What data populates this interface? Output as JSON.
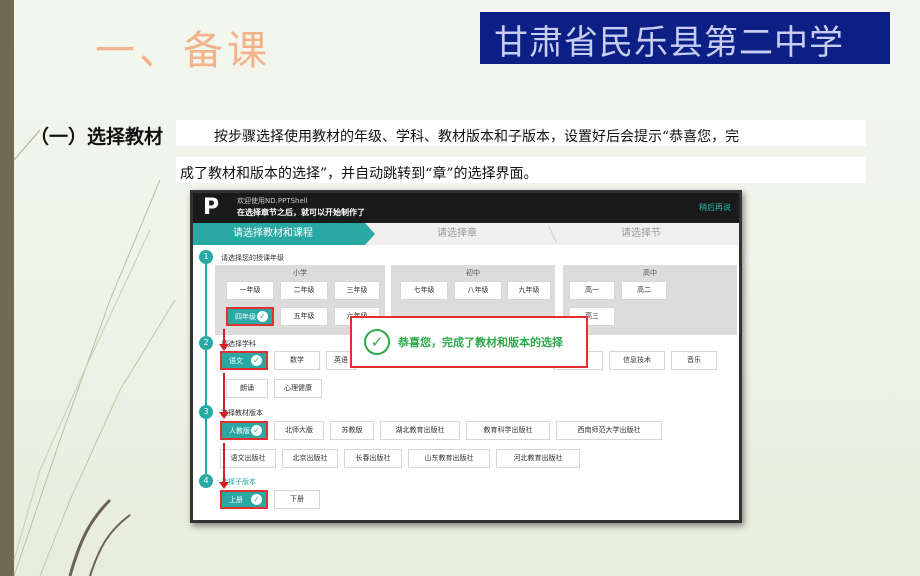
{
  "slide": {
    "title": "一、备课",
    "school": "甘肃省民乐县第二中学",
    "section_label": "（一）选择教材",
    "desc_line1": "按步骤选择使用教材的年级、学科、教材版本和子版本，设置好后会提示“恭喜您，完",
    "desc_line2": "成了教材和版本的选择”，并自动跳转到“章”的选择界面。"
  },
  "app": {
    "logo": "P",
    "welcome": "欢迎使用ND.PPTShell",
    "instruction": "在选择章节之后，就可以开始制作了",
    "later_link": "稍后再说",
    "steps": [
      "请选择教材和课程",
      "请选择章",
      "请选择节"
    ],
    "sections": [
      {
        "num": "1",
        "title": "请选择您的授课年级"
      },
      {
        "num": "2",
        "title": "请选择学科"
      },
      {
        "num": "3",
        "title": "选择教材版本"
      },
      {
        "num": "4",
        "title": "选择子版本"
      }
    ],
    "groups": {
      "primary": "小学",
      "middle": "初中",
      "high": "高中"
    },
    "grades_primary": [
      "一年级",
      "二年级",
      "三年级",
      "四年级",
      "五年级",
      "六年级"
    ],
    "grades_middle": [
      "七年级",
      "八年级",
      "九年级"
    ],
    "grades_high": [
      "高一",
      "高二",
      "高三"
    ],
    "subjects": [
      "语文",
      "数学",
      "英语",
      "技术",
      "信息技术",
      "音乐",
      "朗诵",
      "心理健康"
    ],
    "editions_row1": [
      "人教版",
      "北师大版",
      "苏教版",
      "湖北教育出版社",
      "教育科学出版社",
      "西南师范大学出版社"
    ],
    "editions_row2": [
      "语文出版社",
      "北京出版社",
      "长春出版社",
      "山东教育出版社",
      "河北教育出版社"
    ],
    "sub_editions": [
      "上册",
      "下册"
    ],
    "popup_text": "恭喜您，完成了教材和版本的选择",
    "check_glyph": "✓"
  },
  "colors": {
    "accent": "#29a8a4",
    "highlight": "#e03030",
    "banner": "#0b1f85",
    "title": "#f2b38a",
    "success": "#2ea84a"
  },
  "icons": [
    "check-icon",
    "success-check-icon",
    "logo-icon"
  ]
}
